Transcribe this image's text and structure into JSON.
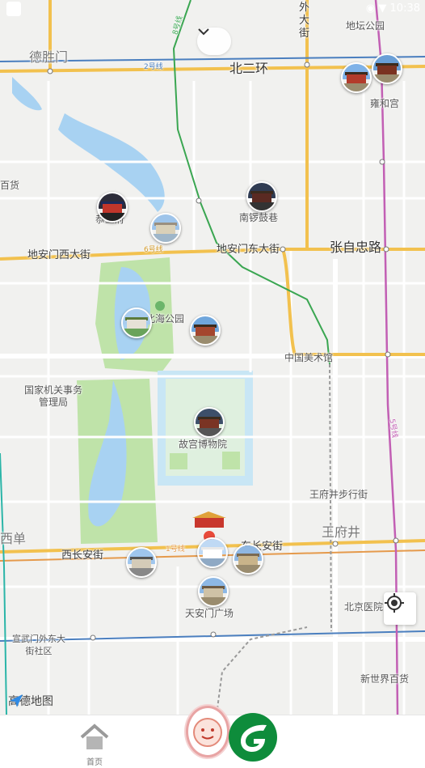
{
  "status_bar": {
    "time": "10:38"
  },
  "map": {
    "roads": [
      {
        "name": "德胜门"
      },
      {
        "name": "北二环"
      },
      {
        "name": "地安门西大街"
      },
      {
        "name": "地安门东大街"
      },
      {
        "name": "张自忠路"
      },
      {
        "name": "西长安街"
      },
      {
        "name": "东长安街"
      },
      {
        "name": "外大街"
      }
    ],
    "places": [
      {
        "name": "地坛公园"
      },
      {
        "name": "雍和宫"
      },
      {
        "name": "南锣鼓巷"
      },
      {
        "name": "恭王府"
      },
      {
        "name": "北海公园"
      },
      {
        "name": "中国美术馆"
      },
      {
        "name": "国家机关事务管理局"
      },
      {
        "name": "故宫博物院"
      },
      {
        "name": "王府井步行街"
      },
      {
        "name": "王府井"
      },
      {
        "name": "西单"
      },
      {
        "name": "天安门广场"
      },
      {
        "name": "北京医院"
      },
      {
        "name": "宣武门外东大街社区"
      },
      {
        "name": "新世界百货"
      },
      {
        "name": "百货"
      }
    ],
    "lines": [
      {
        "name": "2号线"
      },
      {
        "name": "8号线"
      },
      {
        "name": "6号线"
      },
      {
        "name": "1号线"
      },
      {
        "name": "5号线"
      }
    ],
    "brand": "高德地图"
  },
  "tabbar": {
    "home_label": "首页"
  },
  "colors": {
    "ring_road": "#f2c14e",
    "line8": "#3aa651",
    "line5": "#c25fb4",
    "line2": "#4b7fbf",
    "water": "#a8d2f2",
    "park": "#bfe3a9",
    "forbidden_city": "#c8e6f5",
    "brand_green": "#0e8c3b"
  }
}
